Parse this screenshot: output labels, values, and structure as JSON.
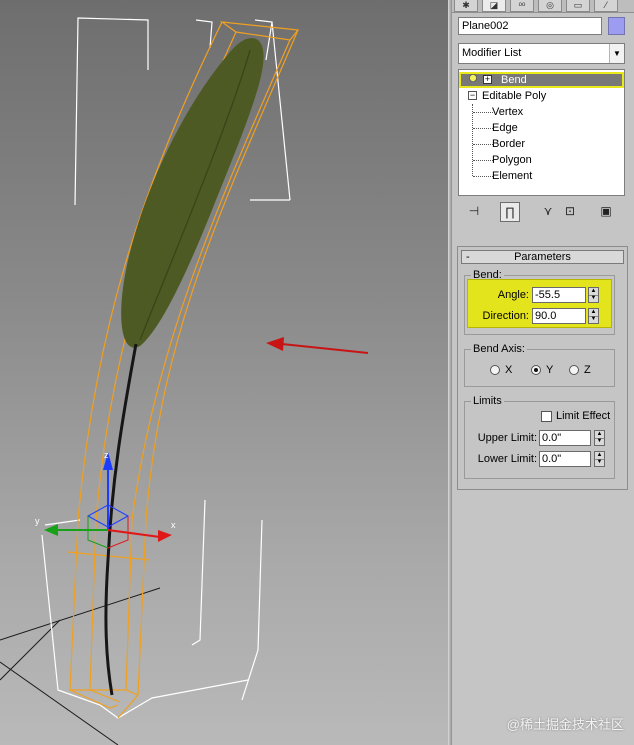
{
  "object": {
    "name": "Plane002",
    "color": "#9c9cf0"
  },
  "modifier_list": {
    "label": "Modifier List"
  },
  "stack": {
    "bend": "Bend",
    "editable_poly": "Editable Poly",
    "sub_objects": [
      "Vertex",
      "Edge",
      "Border",
      "Polygon",
      "Element"
    ]
  },
  "toolbar": {
    "icons": [
      "pin-stack-icon",
      "show-end-result-icon",
      "make-unique-icon",
      "remove-modifier-icon",
      "configure-sets-icon"
    ]
  },
  "parameters": {
    "header": "Parameters",
    "collapse_glyph": "-",
    "bend": {
      "group_label": "Bend:",
      "angle_label": "Angle:",
      "angle_value": "-55.5",
      "direction_label": "Direction:",
      "direction_value": "90.0"
    },
    "bend_axis": {
      "group_label": "Bend Axis:",
      "options": [
        "X",
        "Y",
        "Z"
      ],
      "selected": "Y"
    },
    "limits": {
      "group_label": "Limits",
      "limit_effect_label": "Limit Effect",
      "limit_effect_checked": false,
      "upper_label": "Upper Limit:",
      "upper_value": "0.0\"",
      "lower_label": "Lower Limit:",
      "lower_value": "0.0\""
    }
  },
  "viewport": {
    "gizmo_axes": {
      "x": "x",
      "y": "y",
      "z": "z"
    }
  },
  "colors": {
    "highlight": "#e4e41d",
    "selection": "#f0a020",
    "arrow": "#c81414"
  },
  "watermark": "@稀土掘金技术社区"
}
